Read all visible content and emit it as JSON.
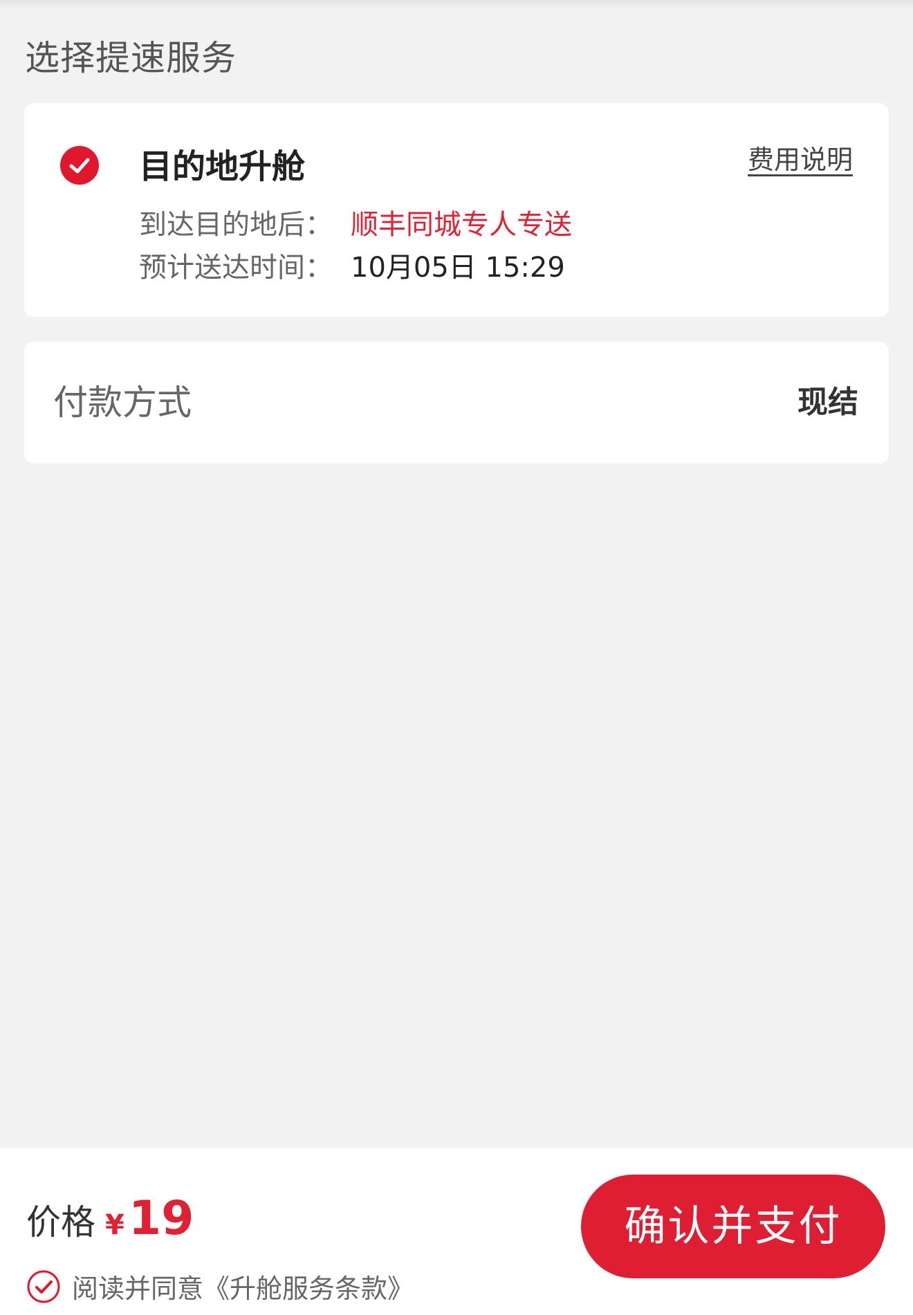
{
  "section_title": "选择提速服务",
  "service": {
    "name": "目的地升舱",
    "fee_link": "费用说明",
    "selected": true,
    "delivery_label": "到达目的地后：",
    "delivery_value": "顺丰同城专人专送",
    "eta_label": "预计送达时间：",
    "eta_value": "10月05日 15:29"
  },
  "payment": {
    "label": "付款方式",
    "value": "现结"
  },
  "bottom": {
    "price_label": "价格",
    "currency": "¥",
    "price": "19",
    "agree_text": "阅读并同意《升舱服务条款》",
    "agreed": true,
    "confirm_label": "确认并支付"
  },
  "colors": {
    "accent": "#de1f33",
    "background": "#f2f2f2",
    "card": "#ffffff"
  }
}
